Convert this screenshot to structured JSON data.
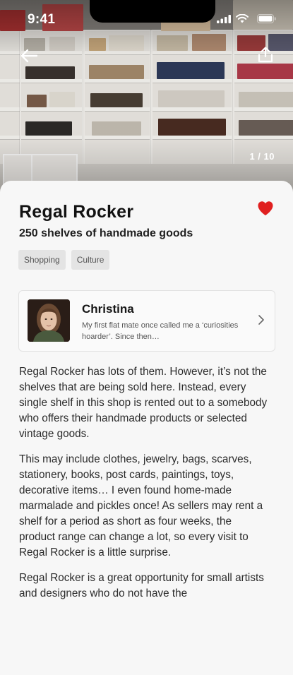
{
  "status": {
    "time": "9:41"
  },
  "hero": {
    "counter": "1 / 10"
  },
  "icons": {
    "back": "arrow-left-icon",
    "share": "share-icon",
    "favorite": "heart-icon",
    "chevron": "chevron-right-icon"
  },
  "place": {
    "title": "Regal Rocker",
    "subtitle": "250 shelves of handmade goods",
    "favorited": true,
    "tags": [
      "Shopping",
      "Culture"
    ]
  },
  "author": {
    "name": "Christina",
    "snippet": "My first flat mate once called me a ‘curiosities hoarder’. Since then…"
  },
  "description": [
    "Regal Rocker has lots of them. However, it’s not the shelves that are being sold here. Instead, every single shelf in this shop is rented out to a somebody who offers their handmade products or selected vintage goods.",
    "This may include clothes, jewelry, bags, scarves, stationery, books, post cards, paintings, toys, decorative items… I even found home-made marmalade and pickles once! As sellers may rent a shelf for a period as short as four weeks, the product range can change a lot, so every visit to Regal Rocker is a little surprise.",
    "Regal Rocker is a great opportunity for small artists and designers who do not have the"
  ],
  "colors": {
    "accent": "#e02020",
    "tag_bg": "#e4e4e4",
    "sheet_bg": "#f7f7f7"
  }
}
